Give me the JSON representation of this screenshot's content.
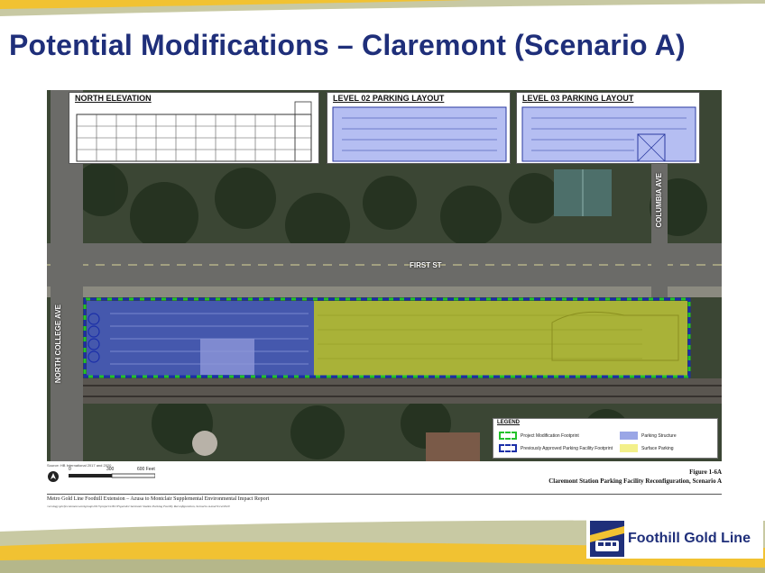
{
  "slide": {
    "title": "Potential Modifications – Claremont (Scenario A)"
  },
  "insets": {
    "north_elevation": "NORTH ELEVATION",
    "level_02": "LEVEL 02 PARKING LAYOUT",
    "level_03": "LEVEL 03 PARKING LAYOUT"
  },
  "streets": {
    "first_st": "FIRST ST",
    "college_ave": "NORTH COLLEGE AVE",
    "columbia_ave": "COLUMBIA AVE"
  },
  "legend": {
    "title": "LEGEND",
    "items": [
      {
        "label": "Project Modification Footprint",
        "color": "#22c22a"
      },
      {
        "label": "Previously Approved Parking Facility Footprint",
        "color": "#1b2fa8"
      },
      {
        "label": "Parking Structure",
        "color": "#9aa6e6"
      },
      {
        "label": "Surface Parking",
        "color": "#f3f08a"
      }
    ]
  },
  "scale": {
    "source": "Source: HB International 2017 and 2020",
    "zero": "0",
    "mid": "300",
    "end": "600 Feet",
    "north_icon": "north-arrow-icon"
  },
  "figure": {
    "number": "Figure 1-6A",
    "caption": "Claremont Station Parking Facility Reconfiguration, Scenario A"
  },
  "report": {
    "title": "Metro Gold Line Foothill Extension – Azusa to Montclair Supplemental Environmental Impact Report",
    "path": "\\\\ecology\\gis\\fs\\common\\workgroup\\2017\\project\\1001\\FigureA\\Claremont Station Parking Facility Reconfiguration, Scenario A.mxd 9/14/2020"
  },
  "logo": {
    "text": "Foothill Gold Line",
    "icon": "train-logo-icon"
  },
  "colors": {
    "title": "#1f2f7a",
    "structure": "#4a5fd6",
    "surface": "#d8e03a",
    "band_gold": "#f1c232",
    "band_olive": "#c8c9a3"
  }
}
